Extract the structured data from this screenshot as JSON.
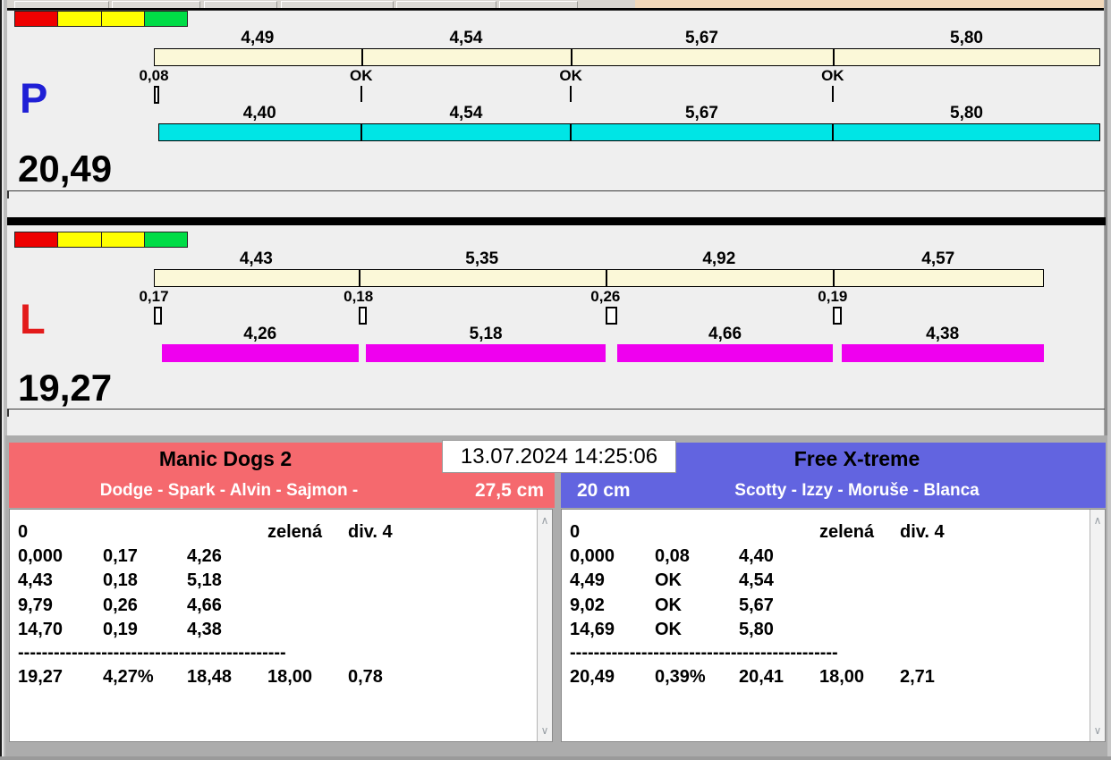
{
  "datetime": "13.07.2024 14:25:06",
  "icons": {
    "scroll_up": "∧",
    "scroll_down": "∨"
  },
  "lanes": [
    {
      "letter": "P",
      "letter_color": "#1F1FD6",
      "total": "20,49",
      "strip_colors": [
        "#EE0000",
        "#FFFF00",
        "#FFFF00",
        "#00DC46"
      ],
      "top_bar": {
        "color": "#FBF8D8",
        "labels": [
          "4,49",
          "4,54",
          "5,67",
          "5,80"
        ],
        "values": [
          4.49,
          4.54,
          5.67,
          5.8
        ]
      },
      "crossings": {
        "labels": [
          "0,08",
          "OK",
          "OK",
          "OK"
        ],
        "values": [
          0.08,
          null,
          null,
          null
        ]
      },
      "run_bar": {
        "color": "#00E5E5",
        "labels": [
          "4,40",
          "4,54",
          "5,67",
          "5,80"
        ],
        "values": [
          4.4,
          4.54,
          5.67,
          5.8
        ],
        "bordered": true
      }
    },
    {
      "letter": "L",
      "letter_color": "#E31B1B",
      "total": "19,27",
      "strip_colors": [
        "#EE0000",
        "#FFFF00",
        "#FFFF00",
        "#00DC46"
      ],
      "top_bar": {
        "color": "#FBF8D8",
        "labels": [
          "4,43",
          "5,35",
          "4,92",
          "4,57"
        ],
        "values": [
          4.43,
          5.35,
          4.92,
          4.57
        ]
      },
      "crossings": {
        "labels": [
          "0,17",
          "0,18",
          "0,26",
          "0,19"
        ],
        "values": [
          0.17,
          0.18,
          0.26,
          0.19
        ]
      },
      "run_bar": {
        "color": "#EF00EF",
        "labels": [
          "4,26",
          "5,18",
          "4,66",
          "4,38"
        ],
        "values": [
          4.26,
          5.18,
          4.66,
          4.38
        ],
        "bordered": false
      }
    }
  ],
  "teams": {
    "left": {
      "color": "#F5696E",
      "name": "Manic Dogs 2",
      "members": "Dodge - Spark - Alvin - Sajmon -",
      "jump_height": "27,5 cm",
      "table": {
        "start_value": "0",
        "color_label": "zelená",
        "division": "div. 4",
        "rows": [
          [
            "0,000",
            "0,17",
            "4,26"
          ],
          [
            "4,43",
            "0,18",
            "5,18"
          ],
          [
            "9,79",
            "0,26",
            "4,66"
          ],
          [
            "14,70",
            "0,19",
            "4,38"
          ]
        ],
        "separator": "---------------------------------------------",
        "totals": [
          "19,27",
          "4,27%",
          "18,48",
          "18,00",
          "0,78"
        ]
      }
    },
    "right": {
      "color": "#6264E0",
      "name": "Free X-treme",
      "members": "Scotty - Izzy - Moruše - Blanca",
      "jump_height": "20 cm",
      "table": {
        "start_value": "0",
        "color_label": "zelená",
        "division": "div. 4",
        "rows": [
          [
            "0,000",
            "0,08",
            "4,40"
          ],
          [
            "4,49",
            "OK",
            "4,54"
          ],
          [
            "9,02",
            "OK",
            "5,67"
          ],
          [
            "14,69",
            "OK",
            "5,80"
          ]
        ],
        "separator": "---------------------------------------------",
        "totals": [
          "20,49",
          "0,39%",
          "20,41",
          "18,00",
          "2,71"
        ]
      }
    }
  }
}
